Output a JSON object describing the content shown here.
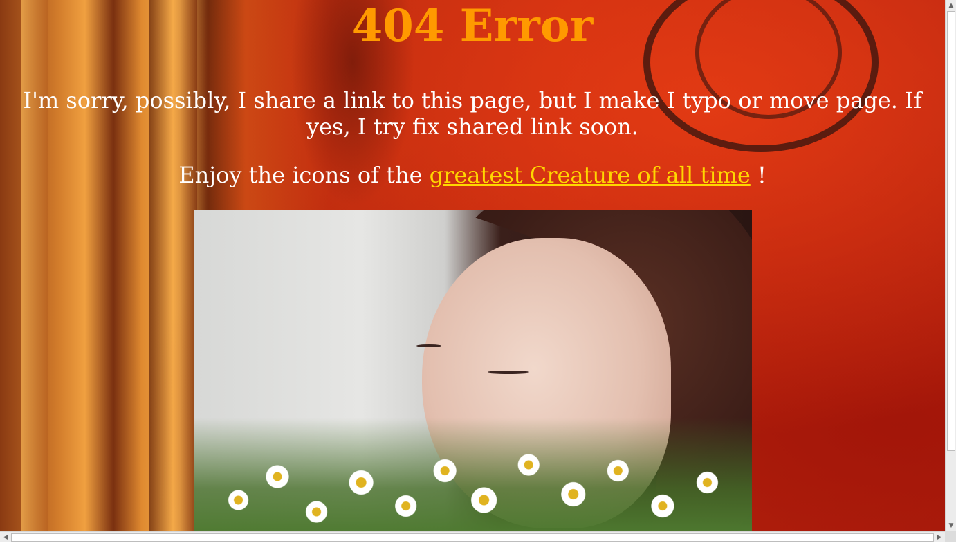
{
  "page": {
    "title": "404 Error",
    "apology": "I'm sorry, possibly, I share a link to this page, but I make I typo or move page. If yes, I try fix shared link soon.",
    "enjoy_prefix": "Enjoy the icons of the ",
    "link_text": "greatest Creature of all time",
    "enjoy_suffix": " !"
  },
  "colors": {
    "title": "#ff9a00",
    "link": "#ffd700",
    "text": "#ffffff",
    "background": "#b3200c"
  },
  "scrollbars": {
    "up_arrow": "▲",
    "down_arrow": "▼",
    "left_arrow": "◀",
    "right_arrow": "▶"
  }
}
